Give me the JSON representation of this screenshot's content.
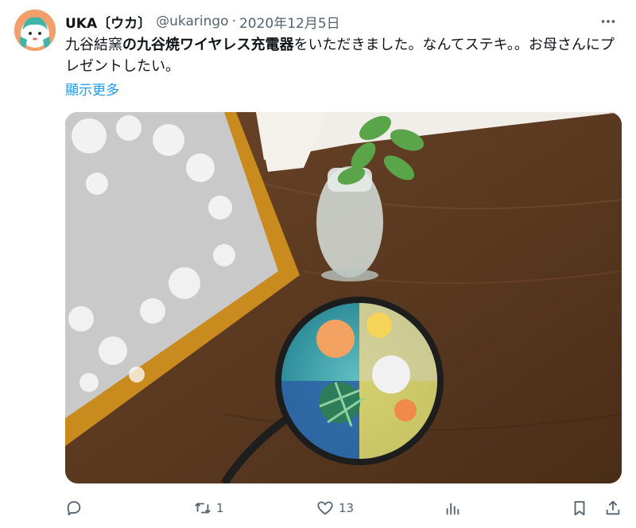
{
  "user": {
    "display_name": "UKA〔ウカ〕",
    "handle": "@ukaringo",
    "separator": "·",
    "date": "2020年12月5日"
  },
  "tweet": {
    "text_part1": "九谷結窯",
    "text_bold": "の九谷焼ワイヤレス充電器",
    "text_part2": "をいただきました。なんてステキ。。お母さんにプレゼントしたい。",
    "show_more": "顯示更多"
  },
  "actions": {
    "reply_count": "",
    "retweet_count": "1",
    "like_count": "13",
    "views_count": ""
  },
  "icons": [
    "more-icon",
    "reply-icon",
    "retweet-icon",
    "like-icon",
    "views-icon",
    "bookmark-icon",
    "share-icon"
  ],
  "colors": {
    "link": "#1d9bf0",
    "secondary_text": "#536471",
    "avatar_bg": "#f2a06b"
  }
}
